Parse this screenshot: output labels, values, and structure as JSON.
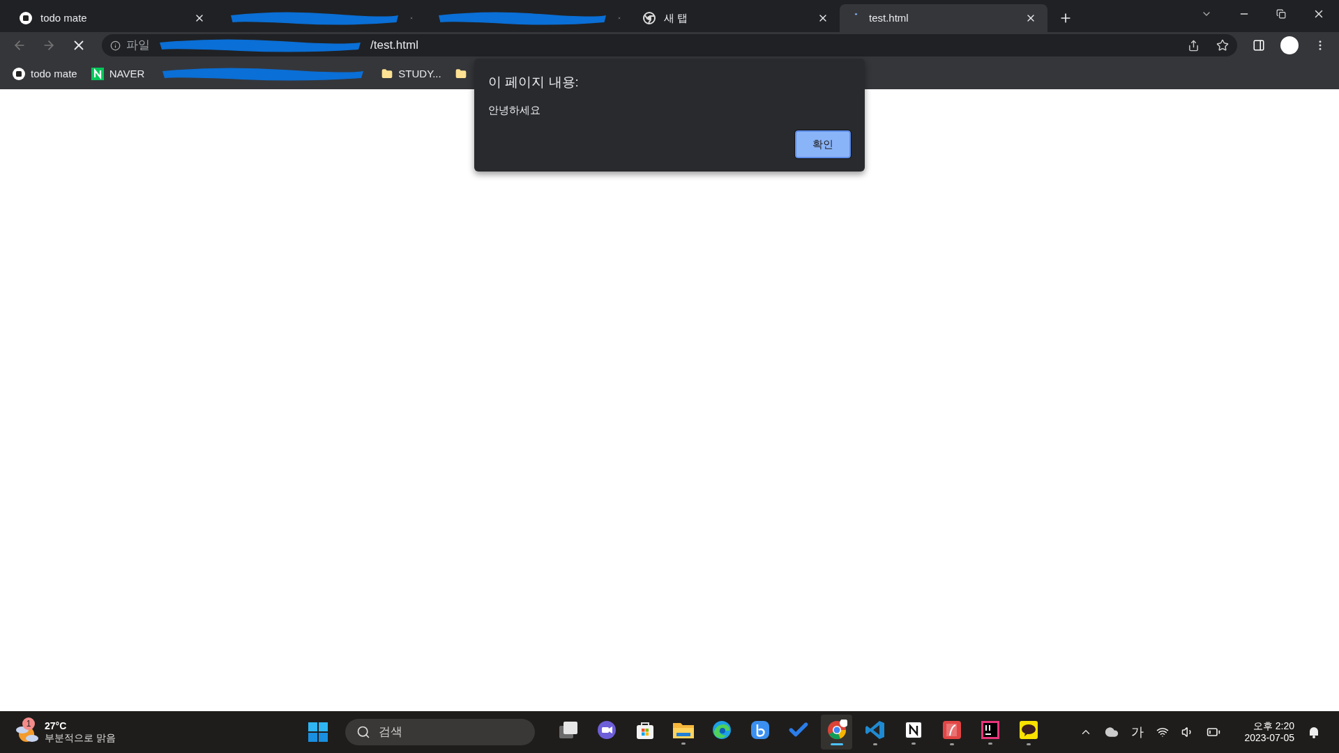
{
  "tabs": [
    {
      "kind": "page",
      "title": "todo mate",
      "selected": false
    },
    {
      "kind": "redacted",
      "selected": false
    },
    {
      "kind": "redacted",
      "selected": false
    },
    {
      "kind": "page",
      "title": "새 탭",
      "selected": false
    },
    {
      "kind": "page",
      "title": "test.html",
      "selected": true
    }
  ],
  "address": {
    "scheme": "파일",
    "path": "/test.html"
  },
  "bookmarks": [
    {
      "kind": "site",
      "label": "todo mate"
    },
    {
      "kind": "site",
      "label": "NAVER"
    },
    {
      "kind": "redacted"
    },
    {
      "kind": "folder",
      "label": "STUDY..."
    },
    {
      "kind": "folder"
    }
  ],
  "dialog": {
    "title": "이 페이지 내용:",
    "message": "안녕하세요",
    "button": "확인"
  },
  "taskbar": {
    "weather": {
      "badge": "1",
      "temperature": "27°C",
      "condition": "부분적으로 맑음"
    },
    "search_placeholder": "검색",
    "apps": [
      {
        "kind": "taskview",
        "open": false,
        "selected": false
      },
      {
        "kind": "chat",
        "open": false,
        "selected": false
      },
      {
        "kind": "store",
        "open": false,
        "selected": false
      },
      {
        "kind": "files",
        "open": true,
        "selected": false
      },
      {
        "kind": "edge",
        "open": false,
        "selected": false
      },
      {
        "kind": "bing",
        "open": false,
        "selected": false
      },
      {
        "kind": "todo",
        "open": false,
        "selected": false
      },
      {
        "kind": "chrome",
        "open": true,
        "selected": true
      },
      {
        "kind": "vscode",
        "open": true,
        "selected": false
      },
      {
        "kind": "notion",
        "open": true,
        "selected": false
      },
      {
        "kind": "reader",
        "open": true,
        "selected": false
      },
      {
        "kind": "intellij",
        "open": true,
        "selected": false
      },
      {
        "kind": "talk",
        "open": true,
        "selected": false
      }
    ],
    "ime": "가",
    "time": "오후 2:20",
    "date": "2023-07-05"
  }
}
